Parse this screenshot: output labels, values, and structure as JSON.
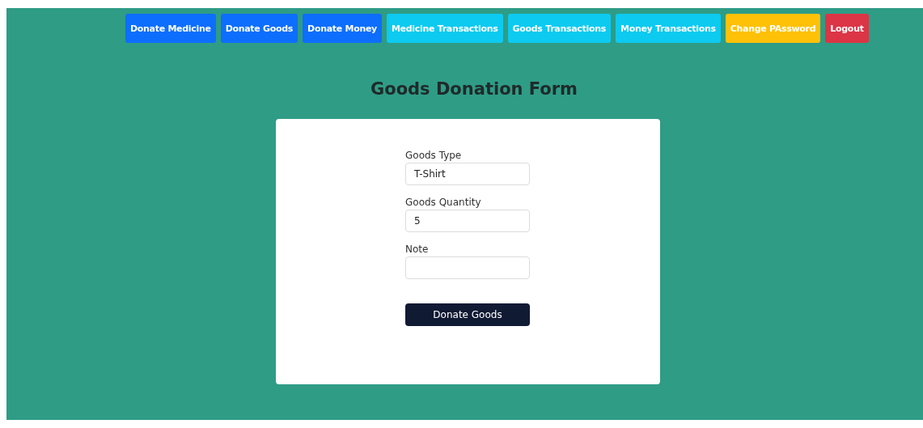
{
  "nav": [
    {
      "label": "Donate Medicine",
      "kind": "primary"
    },
    {
      "label": "Donate Goods",
      "kind": "primary"
    },
    {
      "label": "Donate Money",
      "kind": "primary"
    },
    {
      "label": "Medicine Transactions",
      "kind": "info"
    },
    {
      "label": "Goods Transactions",
      "kind": "info"
    },
    {
      "label": "Money Transactions",
      "kind": "info"
    },
    {
      "label": "Change PAssword",
      "kind": "warning"
    },
    {
      "label": "Logout",
      "kind": "danger"
    }
  ],
  "title": "Goods Donation Form",
  "fields": [
    {
      "label": "Goods Type",
      "value": "T-Shirt"
    },
    {
      "label": "Goods Quantity",
      "value": "5"
    },
    {
      "label": "Note"
    }
  ],
  "submit": "Donate Goods"
}
